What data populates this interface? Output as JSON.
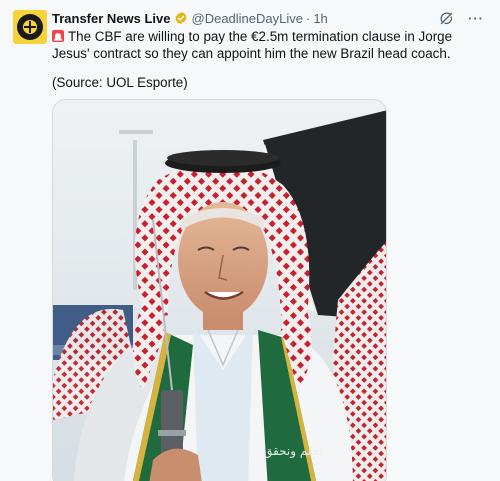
{
  "tweet": {
    "display_name": "Transfer News Live",
    "handle": "@DeadlineDayLive",
    "separator": "·",
    "time": "1h",
    "more_label": "···",
    "text": "The CBF are willing to pay the €2.5m termination clause in Jorge Jesus' contract so they can appoint him the new Brazil head coach.",
    "source": "(Source: UOL Esporte)"
  },
  "icons": {
    "avatar": "football-logo-icon",
    "verified": "gold-verified-badge-icon",
    "grok": "grok-slash-icon",
    "more": "more-horizontal-icon",
    "siren": "siren-emoji-icon"
  },
  "media": {
    "alt": "Photo of a man wearing a red-and-white keffiyeh and green sash",
    "sash_text": "نحلم ونحقق"
  },
  "colors": {
    "verified": "#e2b719",
    "avatar_bg": "#f7d33b",
    "text": "#0f1419",
    "muted": "#536471"
  }
}
